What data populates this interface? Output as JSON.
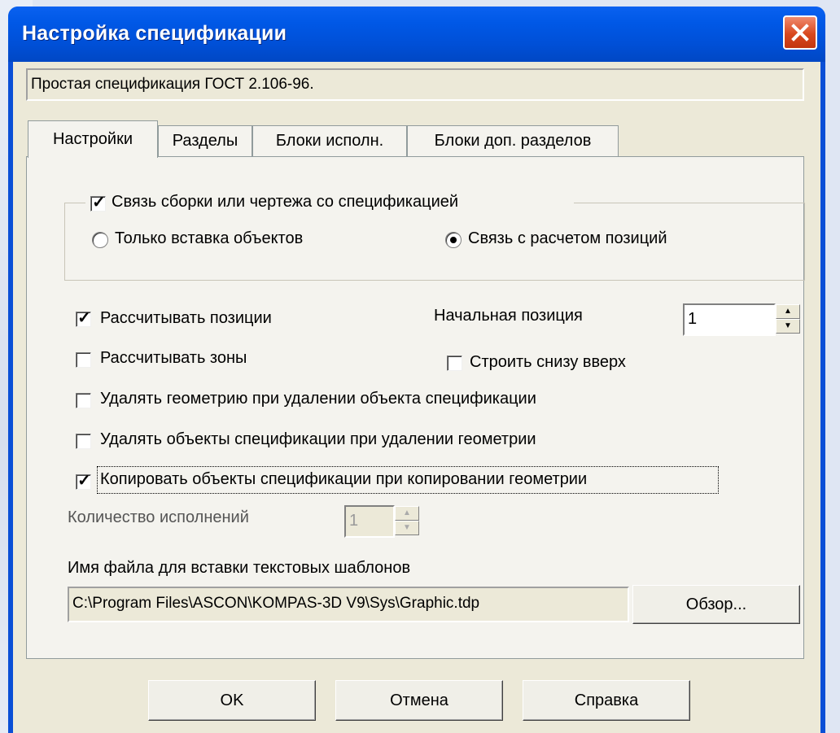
{
  "window": {
    "title": "Настройка спецификации",
    "close_icon": "close-icon",
    "accent_color": "#0a4fd6"
  },
  "description": "Простая спецификация ГОСТ 2.106-96.",
  "tabs": [
    {
      "label": "Настройки",
      "active": true
    },
    {
      "label": "Разделы",
      "active": false
    },
    {
      "label": "Блоки исполн.",
      "active": false
    },
    {
      "label": "Блоки доп. разделов",
      "active": false
    }
  ],
  "settings": {
    "link_group": {
      "checkbox_label": "Связь сборки или чертежа со спецификацией",
      "checked": true,
      "radio_insert_only": "Только вставка объектов",
      "radio_insert_only_selected": false,
      "radio_calc_positions": "Связь с расчетом позиций",
      "radio_calc_positions_selected": true
    },
    "calc_positions": {
      "label": "Рассчитывать позиции",
      "checked": true
    },
    "start_position": {
      "label": "Начальная позиция",
      "value": "1"
    },
    "calc_zones": {
      "label": "Рассчитывать зоны",
      "checked": false
    },
    "build_bottom_up": {
      "label": "Строить снизу вверх",
      "checked": false
    },
    "delete_geometry": {
      "label": "Удалять геометрию при удалении объекта спецификации",
      "checked": false
    },
    "delete_objects": {
      "label": "Удалять объекты спецификации при удалении геометрии",
      "checked": false
    },
    "copy_objects": {
      "label": "Копировать объекты спецификации при копировании геометрии",
      "checked": true
    },
    "variants_count": {
      "label": "Количество исполнений",
      "value": "1"
    },
    "template_file": {
      "label": "Имя файла для вставки текстовых шаблонов",
      "path": "C:\\Program Files\\ASCON\\KOMPAS-3D V9\\Sys\\Graphic.tdp",
      "browse_label": "Обзор..."
    }
  },
  "buttons": {
    "ok": "OK",
    "cancel": "Отмена",
    "help": "Справка"
  }
}
